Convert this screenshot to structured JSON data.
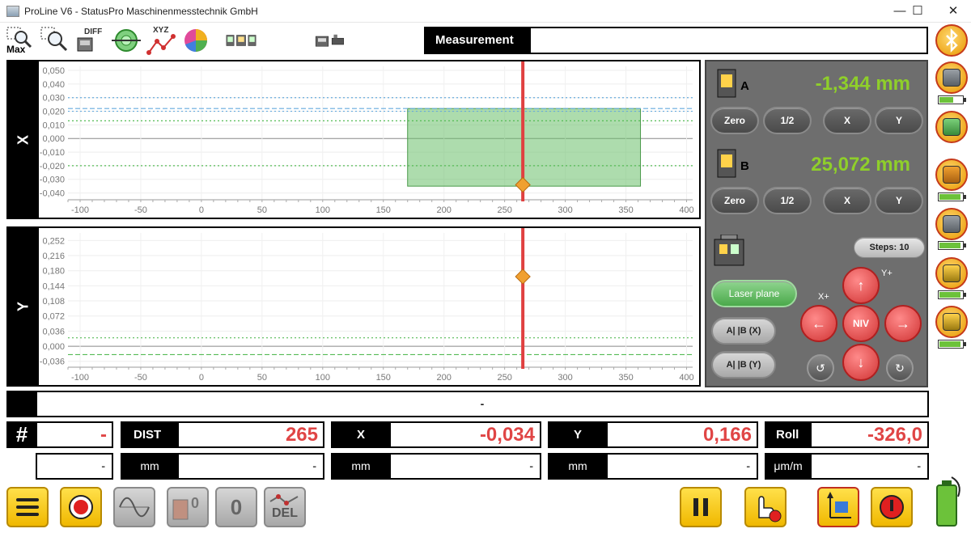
{
  "window": {
    "title": "ProLine V6 - StatusPro Maschinenmesstechnik GmbH",
    "minimize": "—",
    "maximize": "☐",
    "close": "✕"
  },
  "toolbar": {
    "zoom_max_label": "Max",
    "diff_label": "DIFF",
    "xyz_label": "XYZ"
  },
  "measurement": {
    "label": "Measurement",
    "value": ""
  },
  "chart_data": [
    {
      "type": "line",
      "axis_name": "X",
      "x_ticks": [
        -100,
        -50,
        0,
        50,
        100,
        150,
        200,
        250,
        300,
        350,
        400
      ],
      "xlim": [
        -110,
        405
      ],
      "y_ticks": [
        "0,050",
        "0,040",
        "0,030",
        "0,020",
        "0,010",
        "0,000",
        "-0,010",
        "-0,020",
        "-0,030",
        "-0,040"
      ],
      "ylim": [
        -0.045,
        0.053
      ],
      "tolerance_band": {
        "x_from": 170,
        "x_to": 362,
        "y_from": -0.035,
        "y_to": 0.022
      },
      "reference_lines": [
        0.03,
        0.022,
        0.02,
        0.013,
        -0.02
      ],
      "cursor_x": 265,
      "point": {
        "x": 265,
        "y": -0.034
      }
    },
    {
      "type": "line",
      "axis_name": "Y",
      "x_ticks": [
        -100,
        -50,
        0,
        50,
        100,
        150,
        200,
        250,
        300,
        350,
        400
      ],
      "xlim": [
        -110,
        405
      ],
      "y_ticks": [
        "0,252",
        "0,216",
        "0,180",
        "0,144",
        "0,108",
        "0,072",
        "0,036",
        "0,000",
        "-0,036"
      ],
      "ylim": [
        -0.05,
        0.27
      ],
      "reference_lines": [
        0.02,
        -0.02
      ],
      "cursor_x": 265,
      "point": {
        "x": 265,
        "y": 0.166
      }
    }
  ],
  "control_panel": {
    "sensor_a": {
      "letter": "A",
      "value": "-1,344 mm"
    },
    "sensor_b": {
      "letter": "B",
      "value": "25,072 mm"
    },
    "btn_zero": "Zero",
    "btn_half": "1/2",
    "btn_x": "X",
    "btn_y": "Y",
    "steps": "Steps: 10",
    "laser_plane": "Laser plane",
    "parallel_x": "A| |B (X)",
    "parallel_y": "A| |B (Y)",
    "label_xplus": "X+",
    "label_yplus": "Y+",
    "niv": "NIV",
    "arrow_up": "↑",
    "arrow_down": "↓",
    "arrow_left": "←",
    "arrow_right": "→",
    "rotate_ccw": "↺",
    "rotate_cw": "↻"
  },
  "status": {
    "text": "-"
  },
  "readouts": {
    "hash_label": "#",
    "hash_value": "-",
    "hash_sub": "-",
    "dist_label": "DIST",
    "dist_value": "265",
    "dist_unit": "mm",
    "dist_sub": "-",
    "x_label": "X",
    "x_value": "-0,034",
    "x_unit": "mm",
    "x_sub": "-",
    "y_label": "Y",
    "y_value": "0,166",
    "y_unit": "mm",
    "y_sub": "-",
    "roll_label": "Roll",
    "roll_value": "-326,0",
    "roll_unit": "μm/m",
    "roll_sub": "-"
  },
  "bottom": {
    "zero_label": "0",
    "del_label": "DEL"
  },
  "battery_levels": [
    0.6,
    0.9,
    0.9,
    0.9,
    0.9,
    0.9
  ],
  "colors": {
    "accent_green": "#8fcf2a",
    "value_red": "#e04545",
    "cursor_red": "#e04040",
    "band_green": "#6abf6a",
    "marker_orange": "#f0a030"
  }
}
